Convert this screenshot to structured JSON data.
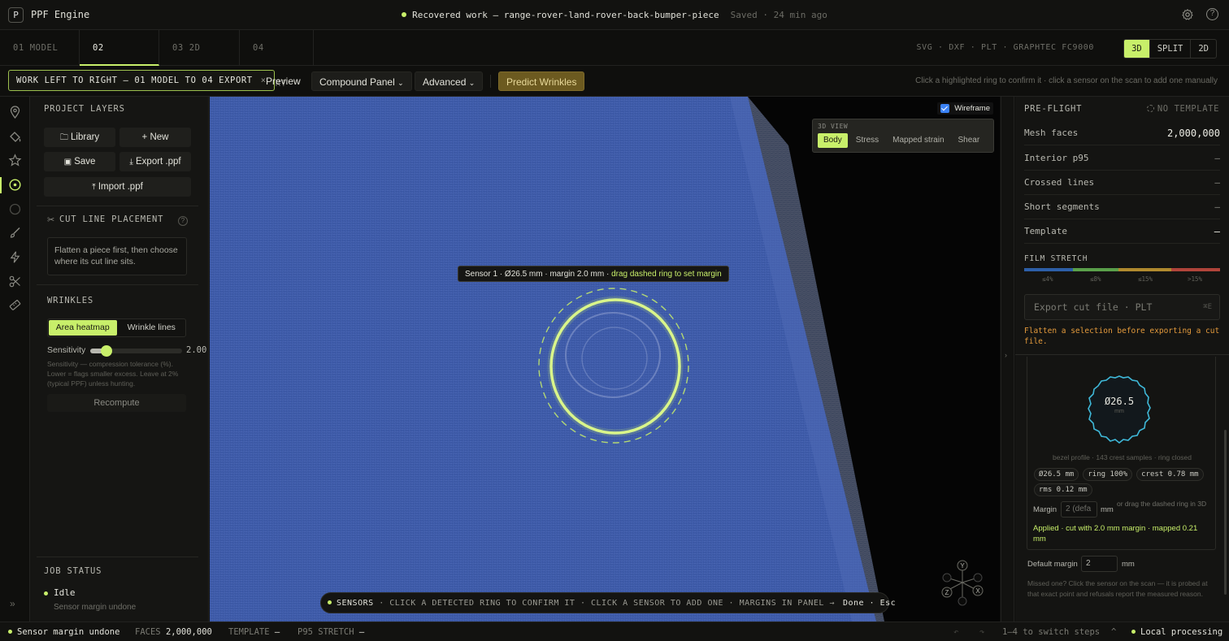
{
  "app": {
    "logo_letter": "P",
    "name": "PPF Engine",
    "doc_status": "Recovered work — range-rover-land-rover-back-bumper-piece",
    "saved": "Saved · 24 min ago"
  },
  "tabs": [
    {
      "label": "01 MODEL",
      "has_dot": true
    },
    {
      "label": "02 FLATTEN",
      "active": true
    },
    {
      "label": "03 2D EDIT"
    },
    {
      "label": "04 EXPORT"
    }
  ],
  "formats": "SVG · DXF · PLT · GRAPHTEC FC9000",
  "view_toggle": [
    "3D",
    "SPLIT",
    "2D"
  ],
  "view_toggle_active": "3D",
  "toolbar": {
    "workflow_hint": "WORK LEFT TO RIGHT — 01 MODEL TO 04 EXPORT",
    "close_glyph": "×",
    "preview": "Preview",
    "compound_panel": "Compound Panel",
    "advanced": "Advanced",
    "predict": "Predict Wrinkles",
    "hint": "Click a highlighted ring to confirm it · click a sensor on the scan to add one manually"
  },
  "left": {
    "project_layers": "PROJECT LAYERS",
    "library": "Library",
    "new": "New",
    "save": "Save",
    "export_ppf": "Export .ppf",
    "import_ppf": "Import .ppf",
    "cut_line_title": "CUT LINE PLACEMENT",
    "cut_line_note": "Flatten a piece first, then choose where its cut line sits.",
    "help_glyph": "?",
    "wrinkles_title": "WRINKLES",
    "area_heatmap": "Area heatmap",
    "wrinkle_lines": "Wrinkle lines",
    "sensitivity_label": "Sensitivity",
    "sensitivity_value": "2.00",
    "sensitivity_fraction": 0.18,
    "sensitivity_help": "Sensitivity — compression tolerance (%). Lower = flags smaller excess. Leave at 2% (typical PPF) unless hunting.",
    "recompute": "Recompute",
    "job_status_title": "JOB STATUS",
    "job_state": "Idle",
    "job_detail": "Sensor margin undone",
    "collapse_glyph": "»"
  },
  "viewport": {
    "wireframe_label": "Wireframe",
    "wireframe_checked": true,
    "view_title": "3D VIEW",
    "view_modes": [
      "Body",
      "Stress",
      "Mapped strain",
      "Shear"
    ],
    "view_mode_active": "Body",
    "ring_tip_main": "Sensor 1 · Ø26.5 mm · margin 2.0 mm · ",
    "ring_tip_action": "drag dashed ring to set margin",
    "sensors_bar": {
      "label": "SENSORS",
      "text": "· CLICK A DETECTED RING TO CONFIRM IT · CLICK A SENSOR TO ADD ONE · MARGINS IN PANEL →",
      "done": "Done · Esc"
    },
    "axes": {
      "y": "Y",
      "x": "X",
      "z": "Z"
    }
  },
  "right": {
    "preflight_title": "PRE-FLIGHT",
    "no_template": "NO TEMPLATE",
    "rows": [
      {
        "label": "Mesh faces",
        "value": "2,000,000",
        "bright": true
      },
      {
        "label": "Interior p95",
        "value": "—"
      },
      {
        "label": "Crossed lines",
        "value": "—"
      },
      {
        "label": "Short segments",
        "value": "—"
      },
      {
        "label": "Template",
        "value": "—",
        "bright": true
      }
    ],
    "film_stretch_title": "FILM STRETCH",
    "stretch_labels": [
      "≤4%",
      "≤8%",
      "≤15%",
      ">15%"
    ],
    "stretch_colors": [
      "#2d5fa8",
      "#5aa04a",
      "#b08a2e",
      "#b0443a"
    ],
    "export_cut": "Export cut file · PLT",
    "export_key": "⌘E",
    "export_warn": "Flatten a selection before exporting a cut file.",
    "sensor_card": {
      "diameter": "Ø26.5",
      "unit": "mm",
      "profile": "bezel profile · 143 crest samples · ring closed",
      "chips": [
        "Ø26.5 mm",
        "ring 100%",
        "crest 0.78 mm",
        "rms 0.12 mm"
      ],
      "margin_label": "Margin",
      "margin_placeholder": "2 (defa",
      "margin_unit": "mm",
      "margin_hint": "or drag the dashed ring in 3D",
      "applied": "Applied · cut with 2.0 mm margin · mapped 0.21 mm"
    },
    "default_margin_label": "Default margin",
    "default_margin_value": "2",
    "default_margin_unit": "mm",
    "missed_note": "Missed one? Click the sensor on the scan — it is probed at that exact point and refusals report the measured reason."
  },
  "status": {
    "state": "Sensor margin undone",
    "faces_label": "FACES",
    "faces_value": "2,000,000",
    "template_label": "TEMPLATE",
    "template_value": "—",
    "p95_label": "P95 STRETCH",
    "p95_value": "—",
    "undo_glyph": "↶",
    "redo_glyph": "↷",
    "switch_hint": "1–4 to switch steps",
    "caret": "^",
    "processing": "Local processing"
  }
}
